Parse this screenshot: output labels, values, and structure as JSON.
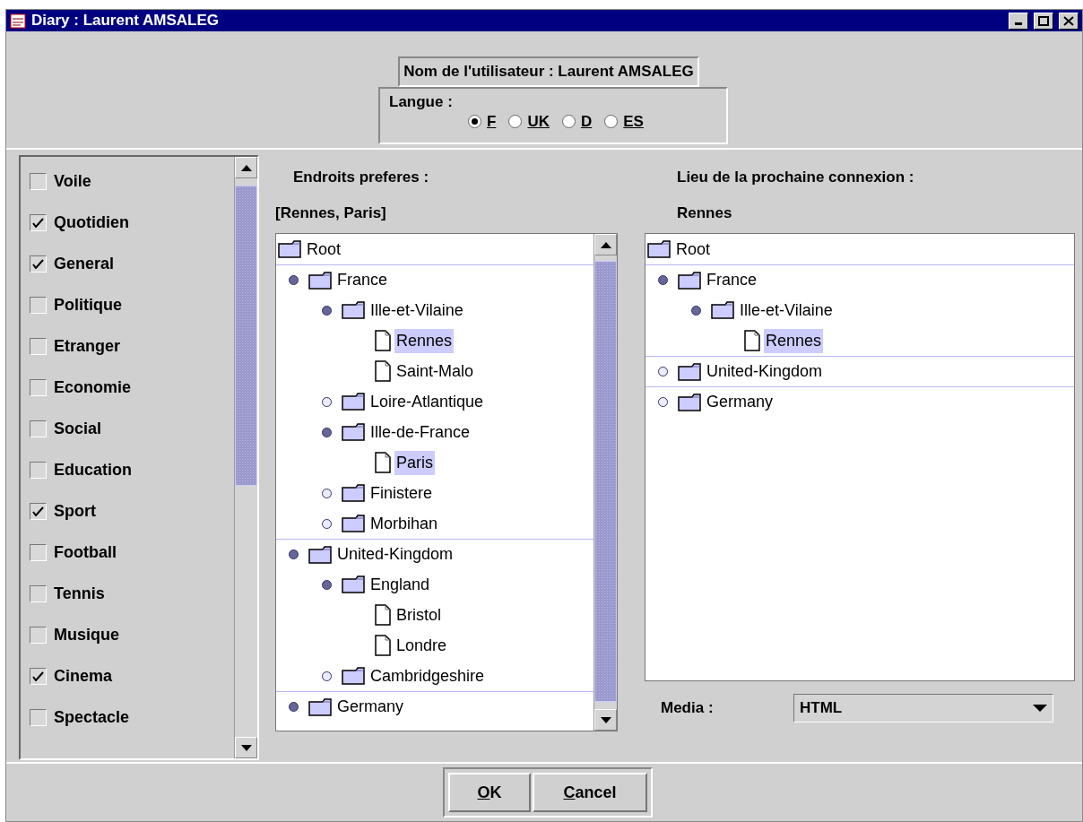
{
  "window": {
    "title": "Diary : Laurent AMSALEG"
  },
  "user": {
    "label": "Nom de l'utilisateur : Laurent AMSALEG"
  },
  "language": {
    "label": "Langue :",
    "options": [
      {
        "label": "F",
        "selected": true
      },
      {
        "label": "UK",
        "selected": false
      },
      {
        "label": "D",
        "selected": false
      },
      {
        "label": "ES",
        "selected": false
      }
    ]
  },
  "categories": [
    {
      "label": "Voile",
      "checked": false
    },
    {
      "label": "Quotidien",
      "checked": true
    },
    {
      "label": "General",
      "checked": true
    },
    {
      "label": "Politique",
      "checked": false
    },
    {
      "label": "Etranger",
      "checked": false
    },
    {
      "label": "Economie",
      "checked": false
    },
    {
      "label": "Social",
      "checked": false
    },
    {
      "label": "Education",
      "checked": false
    },
    {
      "label": "Sport",
      "checked": true
    },
    {
      "label": "Football",
      "checked": false
    },
    {
      "label": "Tennis",
      "checked": false
    },
    {
      "label": "Musique",
      "checked": false
    },
    {
      "label": "Cinema",
      "checked": true
    },
    {
      "label": "Spectacle",
      "checked": false
    }
  ],
  "favorites": {
    "title": "Endroits preferes :",
    "value": "[Rennes, Paris]",
    "tree": {
      "label": "Root",
      "kind": "folder",
      "children": [
        {
          "label": "France",
          "kind": "folder",
          "expanded": true,
          "children": [
            {
              "label": "Ille-et-Vilaine",
              "kind": "folder",
              "expanded": true,
              "children": [
                {
                  "label": "Rennes",
                  "kind": "file",
                  "selected": true
                },
                {
                  "label": "Saint-Malo",
                  "kind": "file",
                  "selected": false
                }
              ]
            },
            {
              "label": "Loire-Atlantique",
              "kind": "folder",
              "expanded": false
            },
            {
              "label": "Ille-de-France",
              "kind": "folder",
              "expanded": true,
              "children": [
                {
                  "label": "Paris",
                  "kind": "file",
                  "selected": true
                }
              ]
            },
            {
              "label": "Finistere",
              "kind": "folder",
              "expanded": false
            },
            {
              "label": "Morbihan",
              "kind": "folder",
              "expanded": false
            }
          ]
        },
        {
          "label": "United-Kingdom",
          "kind": "folder",
          "expanded": true,
          "children": [
            {
              "label": "England",
              "kind": "folder",
              "expanded": true,
              "children": [
                {
                  "label": "Bristol",
                  "kind": "file",
                  "selected": false
                },
                {
                  "label": "Londre",
                  "kind": "file",
                  "selected": false
                }
              ]
            },
            {
              "label": "Cambridgeshire",
              "kind": "folder",
              "expanded": false
            }
          ]
        },
        {
          "label": "Germany",
          "kind": "folder",
          "expanded": true
        }
      ]
    }
  },
  "next_connection": {
    "title": "Lieu de la prochaine connexion :",
    "value": "Rennes",
    "tree": {
      "label": "Root",
      "kind": "folder",
      "children": [
        {
          "label": "France",
          "kind": "folder",
          "expanded": true,
          "children": [
            {
              "label": "Ille-et-Vilaine",
              "kind": "folder",
              "expanded": true,
              "children": [
                {
                  "label": "Rennes",
                  "kind": "file",
                  "selected": true
                }
              ]
            }
          ]
        },
        {
          "label": "United-Kingdom",
          "kind": "folder",
          "expanded": false
        },
        {
          "label": "Germany",
          "kind": "folder",
          "expanded": false
        }
      ]
    }
  },
  "media": {
    "label": "Media :",
    "value": "HTML"
  },
  "buttons": [
    "OK",
    "Cancel"
  ]
}
